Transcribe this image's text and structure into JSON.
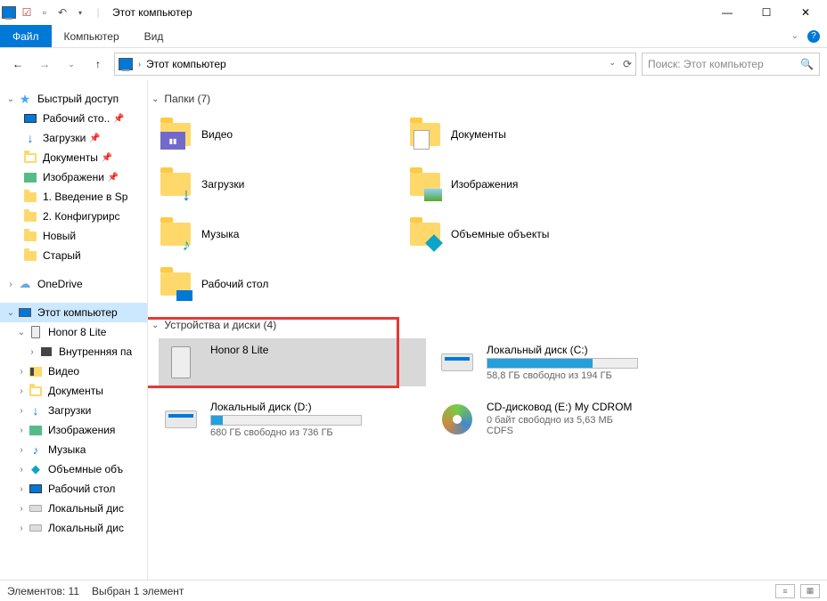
{
  "titlebar": {
    "title": "Этот компьютер"
  },
  "ribbon": {
    "file": "Файл",
    "computer": "Компьютер",
    "view": "Вид"
  },
  "address": {
    "text": "Этот компьютер"
  },
  "search": {
    "placeholder": "Поиск: Этот компьютер"
  },
  "sidebar": {
    "quick": "Быстрый доступ",
    "desktop": "Рабочий сто..",
    "downloads": "Загрузки",
    "documents": "Документы",
    "pictures": "Изображени",
    "f1": "1. Введение в Sp",
    "f2": "2. Конфигурирс",
    "f3": "Новый",
    "f4": "Старый",
    "onedrive": "OneDrive",
    "thispc": "Этот компьютер",
    "honor": "Honor 8 Lite",
    "internal": "Внутренняя па",
    "video": "Видео",
    "documents2": "Документы",
    "downloads2": "Загрузки",
    "pictures2": "Изображения",
    "music": "Музыка",
    "objects3d": "Объемные объ",
    "desktop2": "Рабочий стол",
    "localdisk": "Локальный дис",
    "localdisk2": "Локальный дис"
  },
  "groups": {
    "folders": "Папки (7)",
    "devices": "Устройства и диски (4)"
  },
  "folders": {
    "video": "Видео",
    "documents": "Документы",
    "downloads": "Загрузки",
    "pictures": "Изображения",
    "music": "Музыка",
    "objects3d": "Объемные объекты",
    "desktop": "Рабочий стол"
  },
  "drives": {
    "honor": {
      "name": "Honor 8 Lite"
    },
    "c": {
      "name": "Локальный диск (C:)",
      "sub": "58,8 ГБ свободно из 194 ГБ",
      "fill": 70
    },
    "d": {
      "name": "Локальный диск (D:)",
      "sub": "680 ГБ свободно из 736 ГБ",
      "fill": 8
    },
    "cd": {
      "name": "CD-дисковод (E:) My CDROM",
      "sub1": "0 байт свободно из 5,63 МБ",
      "sub2": "CDFS"
    }
  },
  "status": {
    "count": "Элементов: 11",
    "selected": "Выбран 1 элемент"
  }
}
